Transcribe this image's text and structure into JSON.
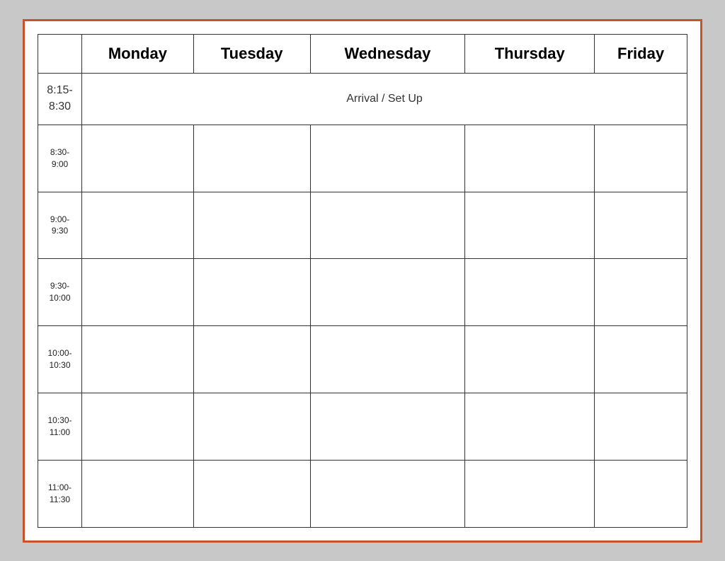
{
  "table": {
    "headers": {
      "time": "",
      "monday": "Monday",
      "tuesday": "Tuesday",
      "wednesday": "Wednesday",
      "thursday": "Thursday",
      "friday": "Friday"
    },
    "rows": [
      {
        "time": "8:15-\n8:30",
        "type": "arrival",
        "label": "Arrival / Set Up",
        "colspan": 5
      },
      {
        "time": "8:30-\n9:00",
        "type": "data"
      },
      {
        "time": "9:00-\n9:30",
        "type": "data"
      },
      {
        "time": "9:30-\n10:00",
        "type": "data"
      },
      {
        "time": "10:00-\n10:30",
        "type": "data"
      },
      {
        "time": "10:30-\n11:00",
        "type": "data"
      },
      {
        "time": "11:00-\n11:30",
        "type": "data"
      }
    ]
  }
}
